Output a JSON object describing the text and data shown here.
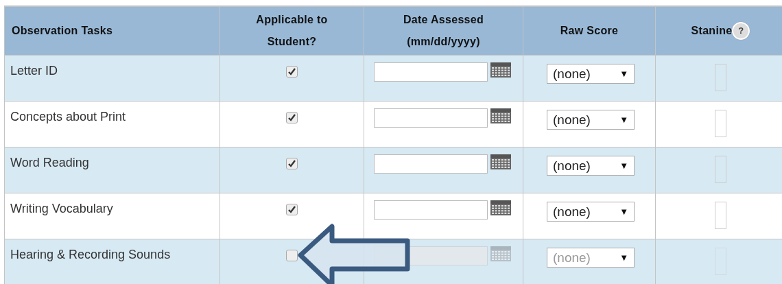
{
  "table": {
    "columns": [
      {
        "label": "Observation Tasks"
      },
      {
        "label": "Applicable to Student?"
      },
      {
        "label": "Date Assessed (mm/dd/yyyy)"
      },
      {
        "label": "Raw Score"
      },
      {
        "label": "Stanine",
        "help": "?"
      }
    ],
    "rows": [
      {
        "task": "Letter ID",
        "applicable": true,
        "raw_score": "(none)",
        "dropdown_arrow": "▼"
      },
      {
        "task": "Concepts about Print",
        "applicable": true,
        "raw_score": "(none)",
        "dropdown_arrow": "▼"
      },
      {
        "task": "Word Reading",
        "applicable": true,
        "raw_score": "(none)",
        "dropdown_arrow": "▼"
      },
      {
        "task": "Writing Vocabulary",
        "applicable": true,
        "raw_score": "(none)",
        "dropdown_arrow": "▼"
      },
      {
        "task": "Hearing & Recording Sounds",
        "applicable": false,
        "raw_score": "(none)",
        "dropdown_arrow": "▼"
      }
    ]
  }
}
